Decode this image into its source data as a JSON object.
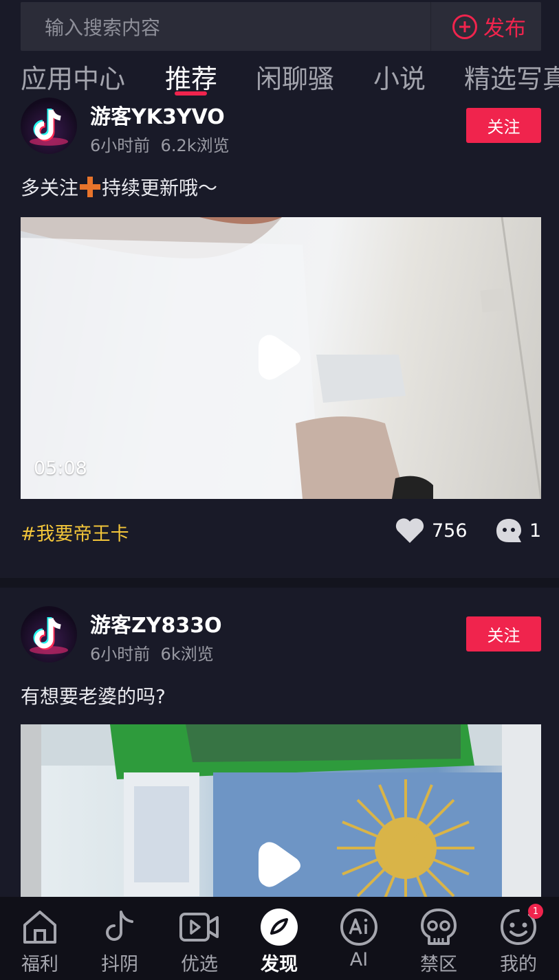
{
  "search": {
    "placeholder": "输入搜索内容",
    "publish_label": "发布"
  },
  "colors": {
    "accent": "#f0244d",
    "tag": "#f2c53a",
    "background": "#191a28"
  },
  "tabs": [
    {
      "label": "应用中心",
      "active": false
    },
    {
      "label": "推荐",
      "active": true
    },
    {
      "label": "闲聊骚",
      "active": false
    },
    {
      "label": "小说",
      "active": false
    },
    {
      "label": "精选写真",
      "active": false
    }
  ],
  "posts": [
    {
      "username": "游客YK3YVO",
      "time": "6小时前",
      "views": "6.2k浏览",
      "follow_label": "关注",
      "caption_before": "多关注",
      "caption_after": "持续更新哦～",
      "duration": "05:08",
      "tag": "#我要帝王卡",
      "likes": "756",
      "comments": "1"
    },
    {
      "username": "游客ZY833O",
      "time": "6小时前",
      "views": "6k浏览",
      "follow_label": "关注",
      "caption": "有想要老婆的吗?"
    }
  ],
  "bottom_nav": [
    {
      "label": "福利",
      "icon": "home-icon"
    },
    {
      "label": "抖阴",
      "icon": "tiktok-icon"
    },
    {
      "label": "优选",
      "icon": "video-icon"
    },
    {
      "label": "发现",
      "icon": "compass-icon",
      "active": true
    },
    {
      "label": "AI",
      "icon": "ai-icon"
    },
    {
      "label": "禁区",
      "icon": "skull-icon"
    },
    {
      "label": "我的",
      "icon": "smile-icon",
      "badge": "1"
    }
  ]
}
